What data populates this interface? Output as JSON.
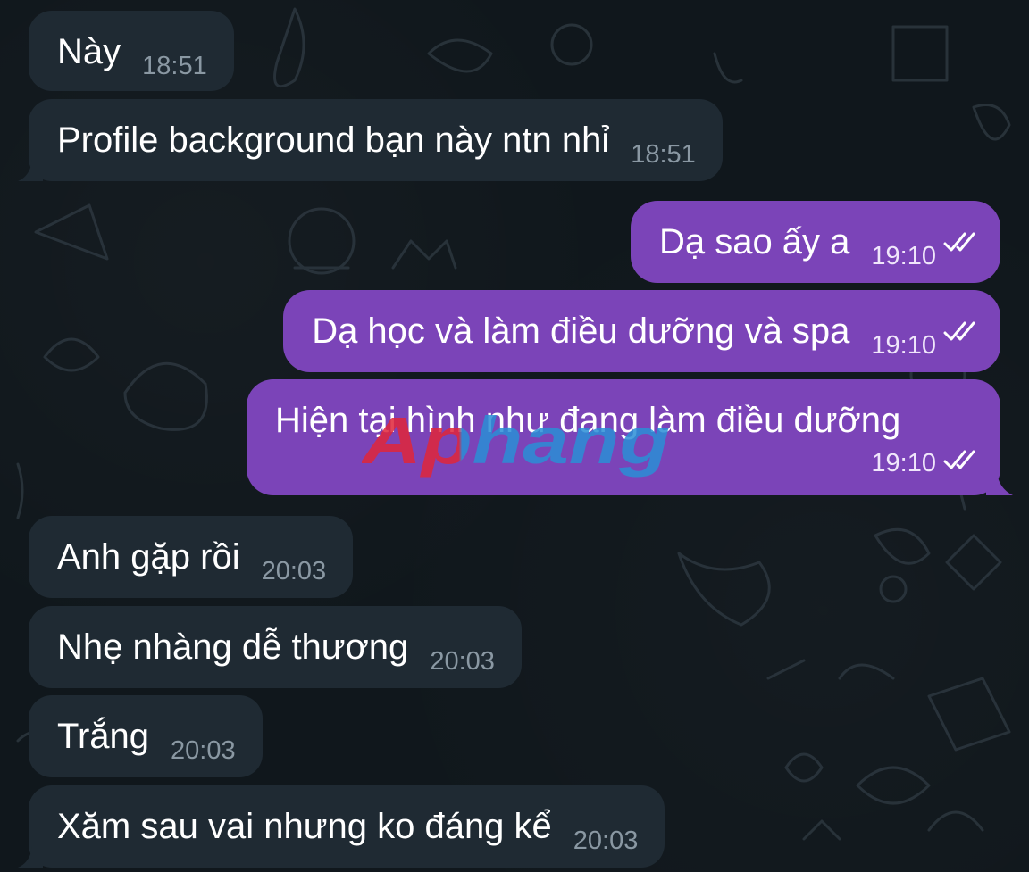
{
  "chat": {
    "messages": [
      {
        "id": "m1",
        "direction": "incoming",
        "text": "Này",
        "time": "18:51"
      },
      {
        "id": "m2",
        "direction": "incoming",
        "text": "Profile background bạn này ntn nhỉ",
        "time": "18:51"
      },
      {
        "id": "m3",
        "direction": "outgoing",
        "text": "Dạ sao ấy a",
        "time": "19:10",
        "status": "read"
      },
      {
        "id": "m4",
        "direction": "outgoing",
        "text": "Dạ học và làm điều dưỡng và spa",
        "time": "19:10",
        "status": "read"
      },
      {
        "id": "m5",
        "direction": "outgoing",
        "text": "Hiện tại hình như đang làm điều dưỡng",
        "time": "19:10",
        "status": "read"
      },
      {
        "id": "m6",
        "direction": "incoming",
        "text": "Anh gặp rồi",
        "time": "20:03"
      },
      {
        "id": "m7",
        "direction": "incoming",
        "text": "Nhẹ nhàng dễ thương",
        "time": "20:03"
      },
      {
        "id": "m8",
        "direction": "incoming",
        "text": "Trắng",
        "time": "20:03"
      },
      {
        "id": "m9",
        "direction": "incoming",
        "text": "Xăm sau vai nhưng ko đáng kể",
        "time": "20:03"
      }
    ]
  },
  "watermark": {
    "text": "Aphang"
  },
  "colors": {
    "background": "#10171c",
    "incoming_bubble": "#1f2a33",
    "outgoing_bubble": "#7b44b8",
    "incoming_time": "#8a98a3",
    "outgoing_time": "#f0e6fb",
    "watermark_red": "#e0263a",
    "watermark_blue": "#2b8fd6"
  },
  "icons": {
    "read_ticks": "double-check-icon"
  }
}
